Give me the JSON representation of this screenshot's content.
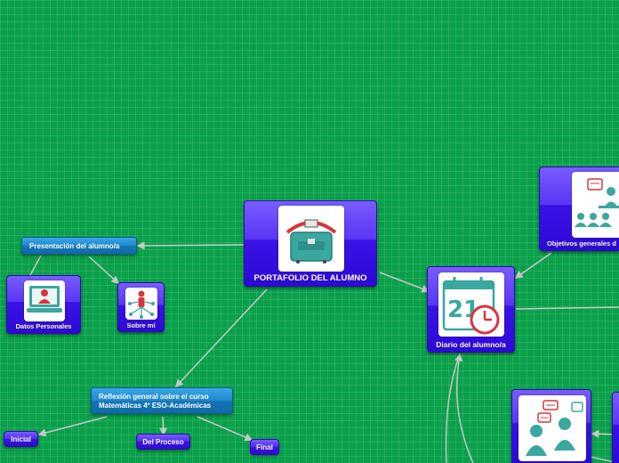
{
  "map": {
    "root": {
      "label": "PORTAFOLIO DEL ALUMNO",
      "icon": "briefcase-icon"
    },
    "diary": {
      "label": "Diario del alumno/a",
      "icon": "calendar-clock-icon"
    },
    "objectives": {
      "label": "Objetivos generales d",
      "icon": "teacher-class-icon"
    },
    "presentation": {
      "label": "Presentación del alumno/a"
    },
    "personal_data": {
      "label": "Datos Personales",
      "icon": "computer-user-icon"
    },
    "about_me": {
      "label": "Sobre mí",
      "icon": "person-network-icon"
    },
    "reflection": {
      "line1": "Reflexión general sobre el curso",
      "line2": "Matemáticas 4º ESO-Académicas"
    },
    "initial": {
      "label": "Inicial"
    },
    "process": {
      "label": "Del Proceso"
    },
    "final": {
      "label": "Final"
    },
    "discussion": {
      "label": "",
      "icon": "discussion-icon"
    }
  },
  "colors": {
    "background": "#0aa04a",
    "card": "#3a12e6",
    "topic": "#1e88cc",
    "connector": "#c8c8c8"
  }
}
